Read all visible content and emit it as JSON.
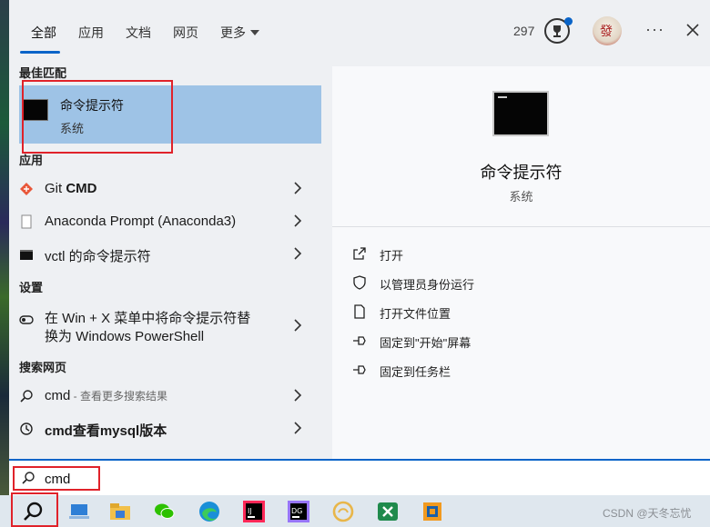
{
  "tabs": [
    {
      "label": "全部",
      "active": true
    },
    {
      "label": "应用",
      "active": false
    },
    {
      "label": "文档",
      "active": false
    },
    {
      "label": "网页",
      "active": false
    },
    {
      "label": "更多",
      "active": false
    }
  ],
  "header": {
    "points": "297",
    "avatar_char": "發",
    "more_options": "···"
  },
  "sections": {
    "best_match": "最佳匹配",
    "apps": "应用",
    "settings": "设置",
    "web": "搜索网页"
  },
  "best_match": {
    "title": "命令提示符",
    "subtitle": "系统"
  },
  "apps": [
    {
      "name": "Git ",
      "bold": "CMD",
      "icon": "git-diamond-icon"
    },
    {
      "name": "Anaconda Prompt (Anaconda3)",
      "icon": "document-icon"
    },
    {
      "name": "vctl 的命令提示符",
      "icon": "terminal-icon"
    }
  ],
  "settings": [
    {
      "line1": "在 Win + X 菜单中将命令提示符替",
      "line2": "换为 Windows PowerShell",
      "icon": "toggle-icon"
    }
  ],
  "web": [
    {
      "query": "cmd",
      "hint": " - 查看更多搜索结果",
      "icon": "search-icon"
    },
    {
      "query": "cmd查看mysql版本",
      "icon": "web-history-icon"
    }
  ],
  "preview": {
    "title": "命令提示符",
    "subtitle": "系统",
    "actions": [
      {
        "label": "打开",
        "icon": "open-external-icon"
      },
      {
        "label": "以管理员身份运行",
        "icon": "shield-icon"
      },
      {
        "label": "打开文件位置",
        "icon": "file-location-icon"
      },
      {
        "label": "固定到\"开始\"屏幕",
        "icon": "pin-icon"
      },
      {
        "label": "固定到任务栏",
        "icon": "pin-icon"
      }
    ]
  },
  "search": {
    "value": "cmd"
  },
  "taskbar": {
    "items": [
      "search-icon",
      "desktop-laptop-icon",
      "file-explorer-icon",
      "wechat-icon",
      "edge-browser-icon",
      "intellij-icon",
      "datagrip-icon",
      "notes-app-icon",
      "excel-icon",
      "virtualbox-icon"
    ],
    "watermark": "CSDN @天冬忘忧"
  },
  "colors": {
    "accent": "#0a64c8",
    "highlight": "#9ec3e6",
    "annotation": "#e0222a"
  }
}
